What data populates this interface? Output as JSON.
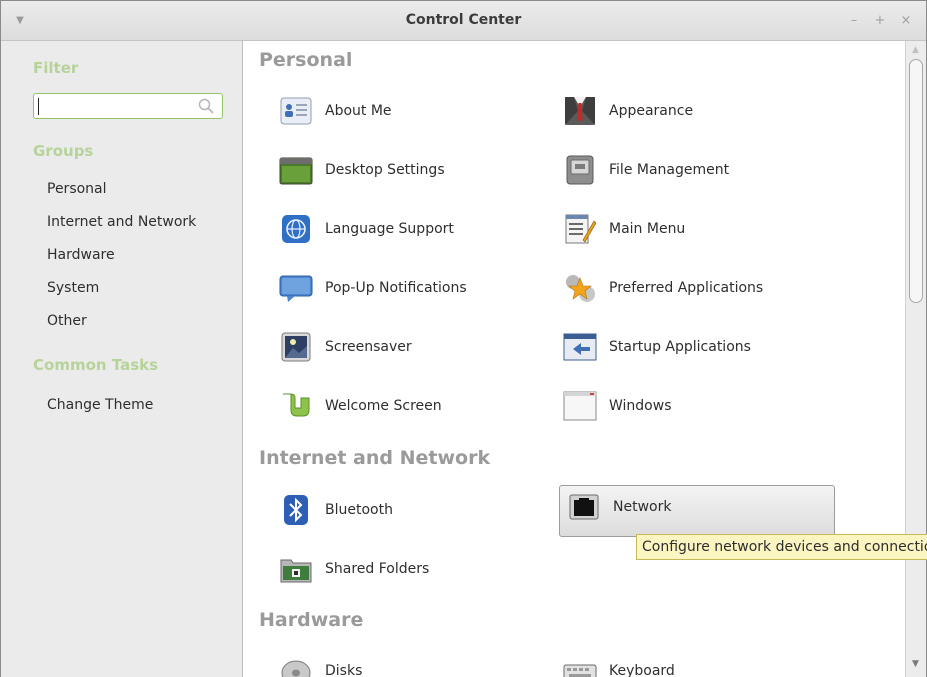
{
  "window": {
    "title": "Control Center",
    "controls": {
      "minimize": "–",
      "maximize": "+",
      "close": "×"
    }
  },
  "sidebar": {
    "filter_heading": "Filter",
    "filter_value": "",
    "groups_heading": "Groups",
    "groups": [
      "Personal",
      "Internet and Network",
      "Hardware",
      "System",
      "Other"
    ],
    "tasks_heading": "Common Tasks",
    "tasks": [
      "Change Theme"
    ]
  },
  "sections": {
    "personal": {
      "title": "Personal",
      "items": [
        "About Me",
        "Appearance",
        "Desktop Settings",
        "File Management",
        "Language Support",
        "Main Menu",
        "Pop-Up Notifications",
        "Preferred Applications",
        "Screensaver",
        "Startup Applications",
        "Welcome Screen",
        "Windows"
      ]
    },
    "internet": {
      "title": "Internet and Network",
      "items": [
        "Bluetooth",
        "Network",
        "Shared Folders"
      ]
    },
    "hardware": {
      "title": "Hardware",
      "items": [
        "Disks",
        "Keyboard"
      ]
    }
  },
  "tooltip": "Configure network devices and connections",
  "icons": {
    "about_me": "contact-card-icon",
    "appearance": "suit-and-tie-icon",
    "desktop_settings": "desktop-icon",
    "file_management": "file-cabinet-icon",
    "language_support": "globe-emblem-icon",
    "main_menu": "menu-editor-icon",
    "notifications": "speech-bubble-icon",
    "preferred_apps": "star-gears-icon",
    "screensaver": "night-scene-icon",
    "startup_apps": "startup-window-icon",
    "welcome": "mint-logo-icon",
    "windows": "window-icon",
    "bluetooth": "bluetooth-icon",
    "network": "ethernet-port-icon",
    "shared_folders": "shared-folder-icon",
    "disks": "disk-icon",
    "keyboard": "keyboard-icon"
  }
}
